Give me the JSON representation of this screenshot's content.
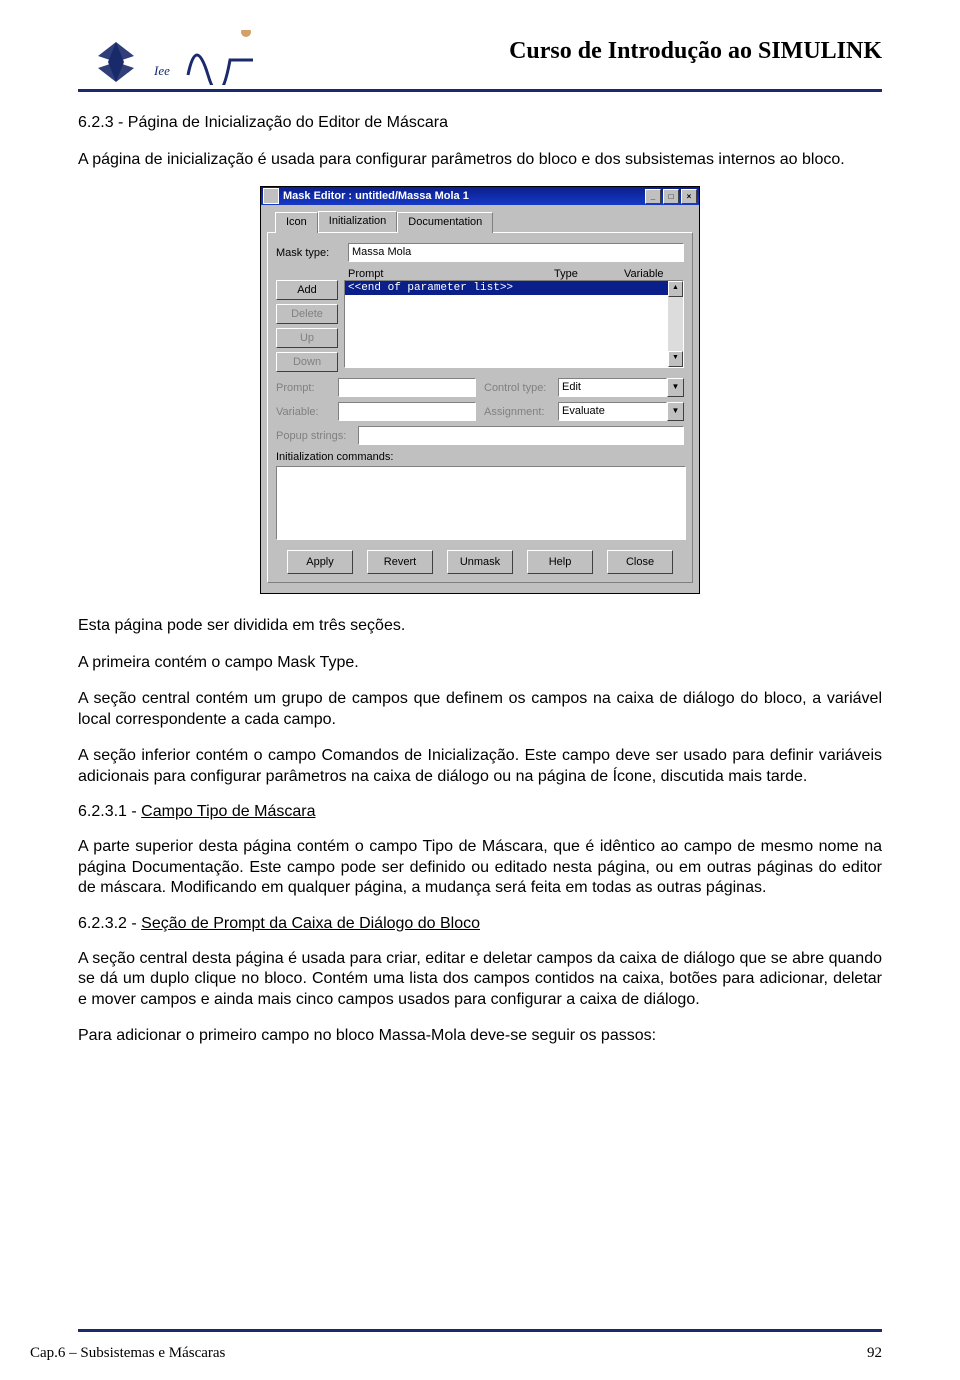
{
  "header": {
    "title": "Curso de Introdução ao SIMULINK"
  },
  "content": {
    "h1": "6.2.3 - Página de Inicialização do Editor de Máscara",
    "p1": "A página de inicialização é usada para configurar parâmetros do bloco e dos subsistemas internos ao bloco.",
    "p2": "Esta página pode ser dividida em três seções.",
    "p3": "A primeira contém o campo Mask Type.",
    "p4": "A seção central contém um grupo de campos que definem os campos na caixa de diálogo do bloco, a variável local correspondente a cada campo.",
    "p5": "A seção inferior contém o campo Comandos de Inicialização. Este campo deve ser usado para definir variáveis adicionais para configurar parâmetros na caixa de diálogo ou na página de Ícone, discutida mais tarde.",
    "sub1_num": "6.2.3.1 - ",
    "sub1_title": "Campo Tipo de Máscara",
    "p6": "A parte superior desta página contém o campo Tipo de Máscara, que é idêntico ao campo de mesmo nome na página Documentação. Este campo pode ser definido ou editado nesta página, ou em outras páginas do editor de máscara. Modificando em qualquer página, a mudança será feita em todas as outras páginas.",
    "sub2_num": "6.2.3.2 - ",
    "sub2_title": "Seção de Prompt da Caixa de Diálogo do Bloco",
    "p7": "A seção central desta página é usada para criar, editar e deletar campos da caixa de diálogo que se abre quando se dá um duplo clique no bloco. Contém uma lista dos campos contidos na caixa, botões para adicionar, deletar e mover campos e ainda mais cinco campos usados para configurar a caixa de diálogo.",
    "p8": "Para adicionar o primeiro campo no bloco Massa-Mola deve-se seguir os passos:"
  },
  "dialog": {
    "title": "Mask Editor : untitled/Massa Mola 1",
    "tabs": {
      "icon": "Icon",
      "init": "Initialization",
      "doc": "Documentation"
    },
    "mask_type_label": "Mask type:",
    "mask_type_value": "Massa Mola",
    "col_prompt": "Prompt",
    "col_type": "Type",
    "col_variable": "Variable",
    "btn_add": "Add",
    "btn_delete": "Delete",
    "btn_up": "Up",
    "btn_down": "Down",
    "list_item": "<<end of parameter list>>",
    "prompt_label": "Prompt:",
    "variable_label": "Variable:",
    "control_type_label": "Control type:",
    "control_type_value": "Edit",
    "assignment_label": "Assignment:",
    "assignment_value": "Evaluate",
    "popup_label": "Popup strings:",
    "init_cmds_label": "Initialization commands:",
    "btn_apply": "Apply",
    "btn_revert": "Revert",
    "btn_unmask": "Unmask",
    "btn_help": "Help",
    "btn_close": "Close"
  },
  "footer": {
    "left": "Cap.6 – Subsistemas e Máscaras",
    "page": "92"
  }
}
